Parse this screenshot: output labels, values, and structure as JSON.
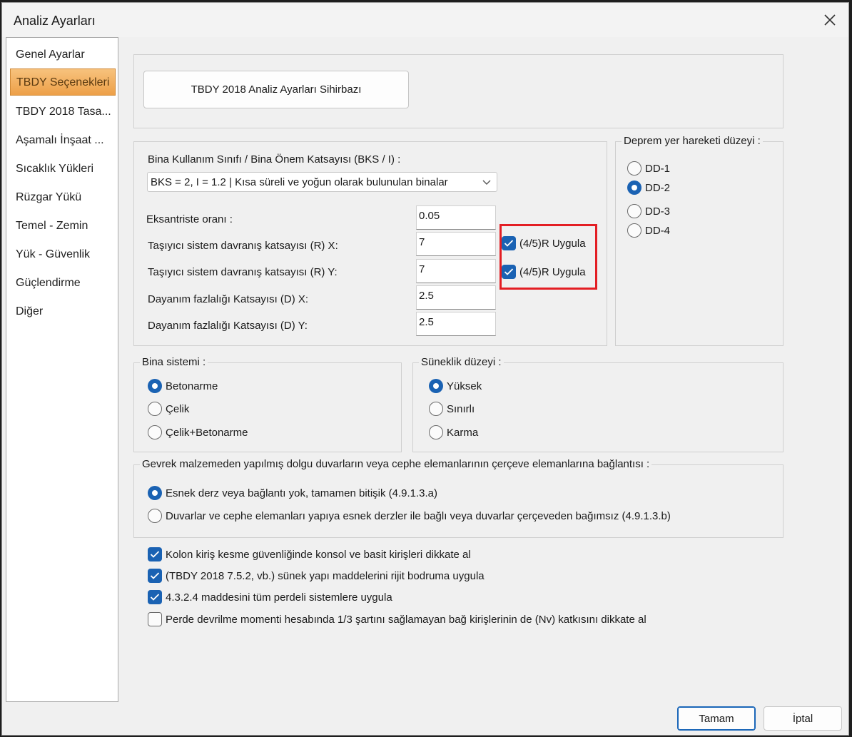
{
  "window": {
    "title": "Analiz Ayarları"
  },
  "sidebar": {
    "items": [
      {
        "label": "Genel Ayarlar",
        "active": false
      },
      {
        "label": "TBDY Seçenekleri",
        "active": true
      },
      {
        "label": "TBDY 2018 Tasa...",
        "active": false
      },
      {
        "label": "Aşamalı İnşaat ...",
        "active": false
      },
      {
        "label": "Sıcaklık Yükleri",
        "active": false
      },
      {
        "label": "Rüzgar Yükü",
        "active": false
      },
      {
        "label": "Temel - Zemin",
        "active": false
      },
      {
        "label": "Yük - Güvenlik",
        "active": false
      },
      {
        "label": "Güçlendirme",
        "active": false
      },
      {
        "label": "Diğer",
        "active": false
      }
    ]
  },
  "wizard": {
    "button_label": "TBDY 2018 Analiz Ayarları Sihirbazı"
  },
  "bks": {
    "title": "Bina Kullanım Sınıfı / Bina Önem Katsayısı (BKS / I) :",
    "selected": "BKS = 2, I = 1.2 | Kısa süreli ve yoğun olarak bulunulan binalar"
  },
  "params": {
    "eksantrisite_label": "Eksantriste oranı :",
    "eksantrisite_value": "0.05",
    "rx_label": "Taşıyıcı sistem davranış katsayısı (R) X:",
    "rx_value": "7",
    "ry_label": "Taşıyıcı sistem davranış katsayısı (R) Y:",
    "ry_value": "7",
    "dx_label": "Dayanım fazlalığı Katsayısı (D) X:",
    "dx_value": "2.5",
    "dy_label": "Dayanım fazlalığı Katsayısı (D) Y:",
    "dy_value": "2.5",
    "r45_x_label": "(4/5)R Uygula",
    "r45_x_checked": true,
    "r45_y_label": "(4/5)R Uygula",
    "r45_y_checked": true
  },
  "deprem": {
    "title": "Deprem yer hareketi düzeyi :",
    "options": [
      {
        "label": "DD-1",
        "selected": false
      },
      {
        "label": "DD-2",
        "selected": true
      },
      {
        "label": "DD-3",
        "selected": false
      },
      {
        "label": "DD-4",
        "selected": false
      }
    ]
  },
  "bina_sistemi": {
    "title": "Bina sistemi :",
    "options": [
      {
        "label": "Betonarme",
        "selected": true
      },
      {
        "label": "Çelik",
        "selected": false
      },
      {
        "label": "Çelik+Betonarme",
        "selected": false
      }
    ]
  },
  "suneklik": {
    "title": "Süneklik düzeyi :",
    "options": [
      {
        "label": "Yüksek",
        "selected": true
      },
      {
        "label": "Sınırlı",
        "selected": false
      },
      {
        "label": "Karma",
        "selected": false
      }
    ]
  },
  "gevrek": {
    "title": "Gevrek malzemeden yapılmış dolgu duvarların veya cephe elemanlarının çerçeve elemanlarına bağlantısı :",
    "options": [
      {
        "label": "Esnek derz veya bağlantı yok, tamamen bitişik (4.9.1.3.a)",
        "selected": true
      },
      {
        "label": "Duvarlar ve cephe elemanları yapıya esnek derzler ile bağlı veya duvarlar çerçeveden bağımsız (4.9.1.3.b)",
        "selected": false
      }
    ]
  },
  "checks": [
    {
      "label": "Kolon kiriş kesme güvenliğinde konsol ve basit kirişleri dikkate al",
      "checked": true
    },
    {
      "label": "(TBDY 2018 7.5.2, vb.) sünek yapı maddelerini rijit bodruma uygula",
      "checked": true
    },
    {
      "label": "4.3.2.4 maddesini tüm perdeli sistemlere uygula",
      "checked": true
    },
    {
      "label": "Perde devrilme momenti hesabında 1/3 şartını sağlamayan bağ kirişlerinin de (Nv) katkısını dikkate al",
      "checked": false
    }
  ],
  "footer": {
    "ok_label": "Tamam",
    "cancel_label": "İptal"
  },
  "colors": {
    "accent": "#1a62b3",
    "highlight_border": "#e31e24",
    "active_tab": "#eda048"
  }
}
